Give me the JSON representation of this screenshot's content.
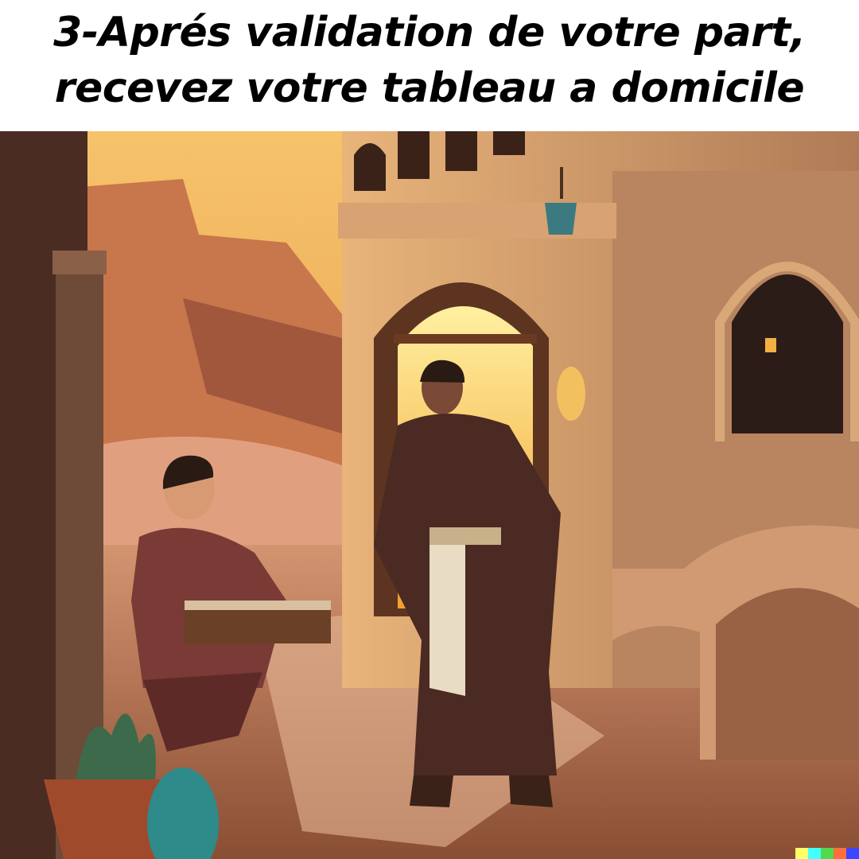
{
  "caption": {
    "line1": "3-Aprés validation de votre part,",
    "line2": "recevez votre tableau a domicile"
  },
  "watermark": {
    "colors": [
      "#ffff66",
      "#42ffff",
      "#51da4c",
      "#ff6e3c",
      "#3c46ff"
    ]
  }
}
